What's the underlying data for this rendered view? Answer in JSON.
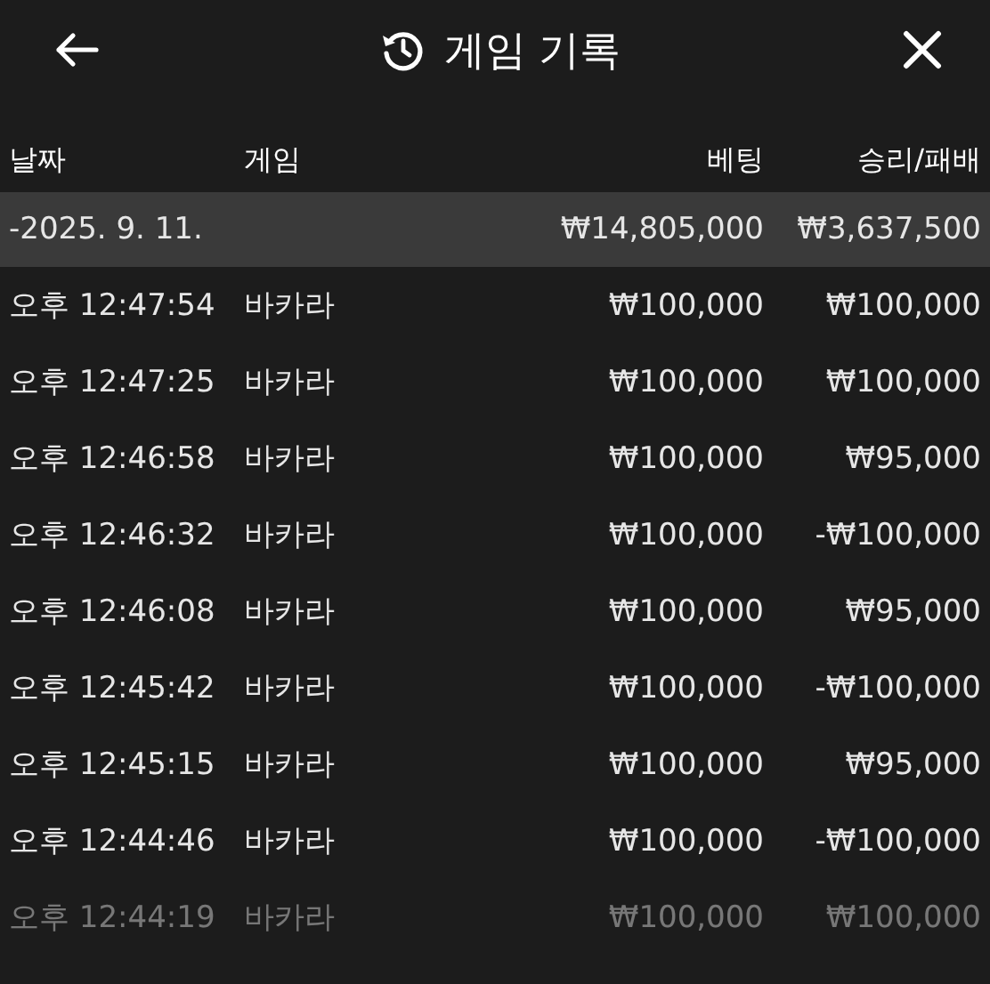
{
  "header": {
    "title": "게임 기록"
  },
  "table": {
    "columns": [
      "날짜",
      "게임",
      "베팅",
      "승리/패배"
    ],
    "group": {
      "date": "-2025. 9. 11.",
      "bet": "₩14,805,000",
      "result": "₩3,637,500"
    },
    "rows": [
      {
        "time": "오후 12:47:54",
        "game": "바카라",
        "bet": "₩100,000",
        "result": "₩100,000"
      },
      {
        "time": "오후 12:47:25",
        "game": "바카라",
        "bet": "₩100,000",
        "result": "₩100,000"
      },
      {
        "time": "오후 12:46:58",
        "game": "바카라",
        "bet": "₩100,000",
        "result": "₩95,000"
      },
      {
        "time": "오후 12:46:32",
        "game": "바카라",
        "bet": "₩100,000",
        "result": "-₩100,000"
      },
      {
        "time": "오후 12:46:08",
        "game": "바카라",
        "bet": "₩100,000",
        "result": "₩95,000"
      },
      {
        "time": "오후 12:45:42",
        "game": "바카라",
        "bet": "₩100,000",
        "result": "-₩100,000"
      },
      {
        "time": "오후 12:45:15",
        "game": "바카라",
        "bet": "₩100,000",
        "result": "₩95,000"
      },
      {
        "time": "오후 12:44:46",
        "game": "바카라",
        "bet": "₩100,000",
        "result": "-₩100,000"
      },
      {
        "time": "오후 12:44:19",
        "game": "바카라",
        "bet": "₩100,000",
        "result": "₩100,000"
      }
    ]
  }
}
